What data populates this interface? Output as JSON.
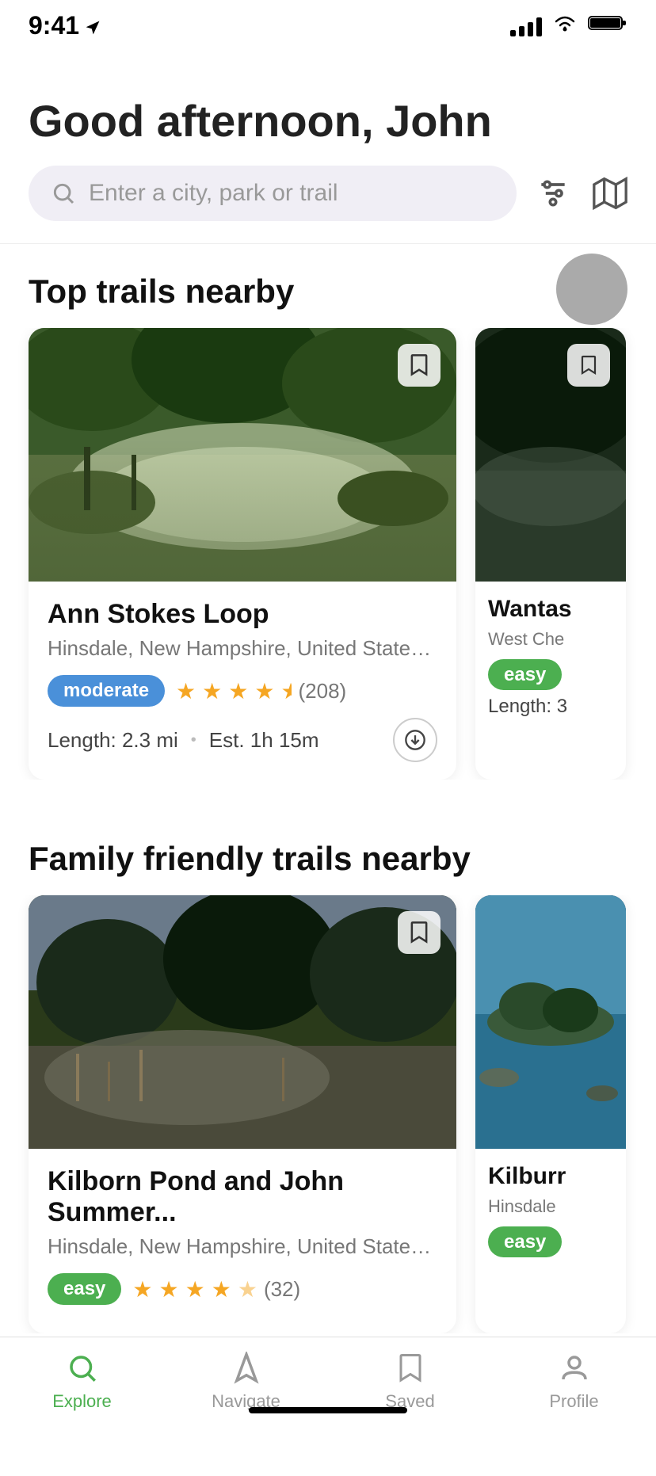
{
  "statusBar": {
    "time": "9:41",
    "navArrow": "▶"
  },
  "greeting": "Good afternoon, John",
  "search": {
    "placeholder": "Enter a city, park or trail"
  },
  "sections": [
    {
      "title": "Top trails nearby",
      "trails": [
        {
          "name": "Ann Stokes Loop",
          "location": "Hinsdale, New Hampshire, United States of...",
          "difficulty": "moderate",
          "difficultyClass": "moderate",
          "stars": 4.5,
          "reviewCount": "(208)",
          "length": "2.3 mi",
          "time": "Est. 1h 15m",
          "imageClass": "trail-image-ann"
        },
        {
          "name": "Wantas",
          "location": "West Che",
          "difficulty": "easy",
          "difficultyClass": "easy",
          "length": "3",
          "imageClass": "trail-image-partial",
          "partial": true
        }
      ]
    },
    {
      "title": "Family friendly trails nearby",
      "trails": [
        {
          "name": "Kilborn Pond and John Summer...",
          "location": "Hinsdale, New Hampshire, United States of...",
          "difficulty": "easy",
          "difficultyClass": "easy",
          "stars": 4.5,
          "reviewCount": "(32)",
          "imageClass": "trail-image-kilborn"
        },
        {
          "name": "Kilburr",
          "location": "Hinsdale",
          "difficulty": "easy",
          "difficultyClass": "easy",
          "imageClass": "trail-image-kilborn2",
          "partial": true
        }
      ]
    }
  ],
  "tabBar": {
    "tabs": [
      {
        "id": "explore",
        "label": "Explore",
        "active": true,
        "icon": "search"
      },
      {
        "id": "navigate",
        "label": "Navigate",
        "active": false,
        "icon": "navigate"
      },
      {
        "id": "saved",
        "label": "Saved",
        "active": false,
        "icon": "bookmark"
      },
      {
        "id": "profile",
        "label": "Profile",
        "active": false,
        "icon": "person"
      }
    ]
  }
}
